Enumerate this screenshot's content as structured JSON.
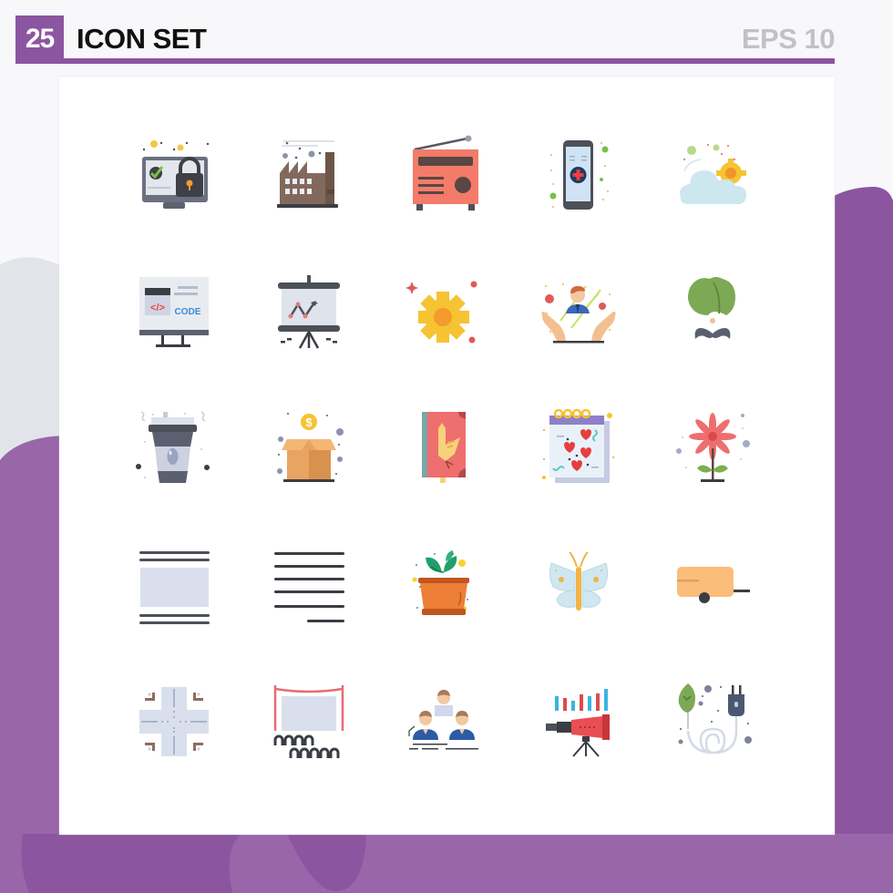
{
  "header": {
    "count": "25",
    "title": "ICON SET",
    "format": "EPS 10"
  },
  "colors": {
    "accent": "#8b55a0",
    "accent_light": "#9966a9",
    "format_text": "#c2c2c5",
    "left_blob": "#e1e5ea",
    "card": "#ffffff"
  },
  "icons": [
    {
      "name": "computer-security-lock-icon"
    },
    {
      "name": "factory-icon"
    },
    {
      "name": "radio-icon"
    },
    {
      "name": "mobile-medical-app-icon"
    },
    {
      "name": "cloud-sun-weather-icon"
    },
    {
      "name": "code-monitor-icon",
      "text": "CODE"
    },
    {
      "name": "presentation-chart-icon"
    },
    {
      "name": "gear-settings-icon"
    },
    {
      "name": "hands-employee-care-icon"
    },
    {
      "name": "turban-mustache-icon"
    },
    {
      "name": "coffee-cup-icon"
    },
    {
      "name": "dollar-box-icon",
      "text": "$"
    },
    {
      "name": "bird-book-icon"
    },
    {
      "name": "love-calendar-icon"
    },
    {
      "name": "flower-icon"
    },
    {
      "name": "image-text-layout-icon"
    },
    {
      "name": "align-right-text-icon"
    },
    {
      "name": "potted-plant-icon"
    },
    {
      "name": "butterfly-icon"
    },
    {
      "name": "camping-trailer-icon"
    },
    {
      "name": "crossroad-map-icon"
    },
    {
      "name": "theater-cinema-icon"
    },
    {
      "name": "team-group-icon"
    },
    {
      "name": "telescope-analytics-icon"
    },
    {
      "name": "eco-power-plug-icon"
    }
  ]
}
